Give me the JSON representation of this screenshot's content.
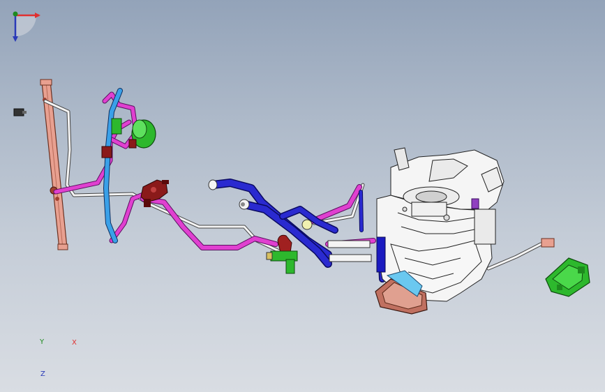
{
  "viewport": {
    "background_top": "#93a3b9",
    "background_bottom": "#d9dde3"
  },
  "colors": {
    "pink_pipe": "#e040d0",
    "blue_hose": "#2a2ad0",
    "white_tube": "#f4f4f4",
    "radiator_rail": "#e8a090",
    "green_part": "#2db82d",
    "red_fitting": "#8a1a1a",
    "hvac_housing": "#f5f5f5"
  },
  "triad": {
    "x_label": "X",
    "y_label": "Y",
    "z_label": "Z",
    "x_color": "#e03030",
    "y_color": "#1e8a1e",
    "z_color": "#2a3ab8"
  }
}
